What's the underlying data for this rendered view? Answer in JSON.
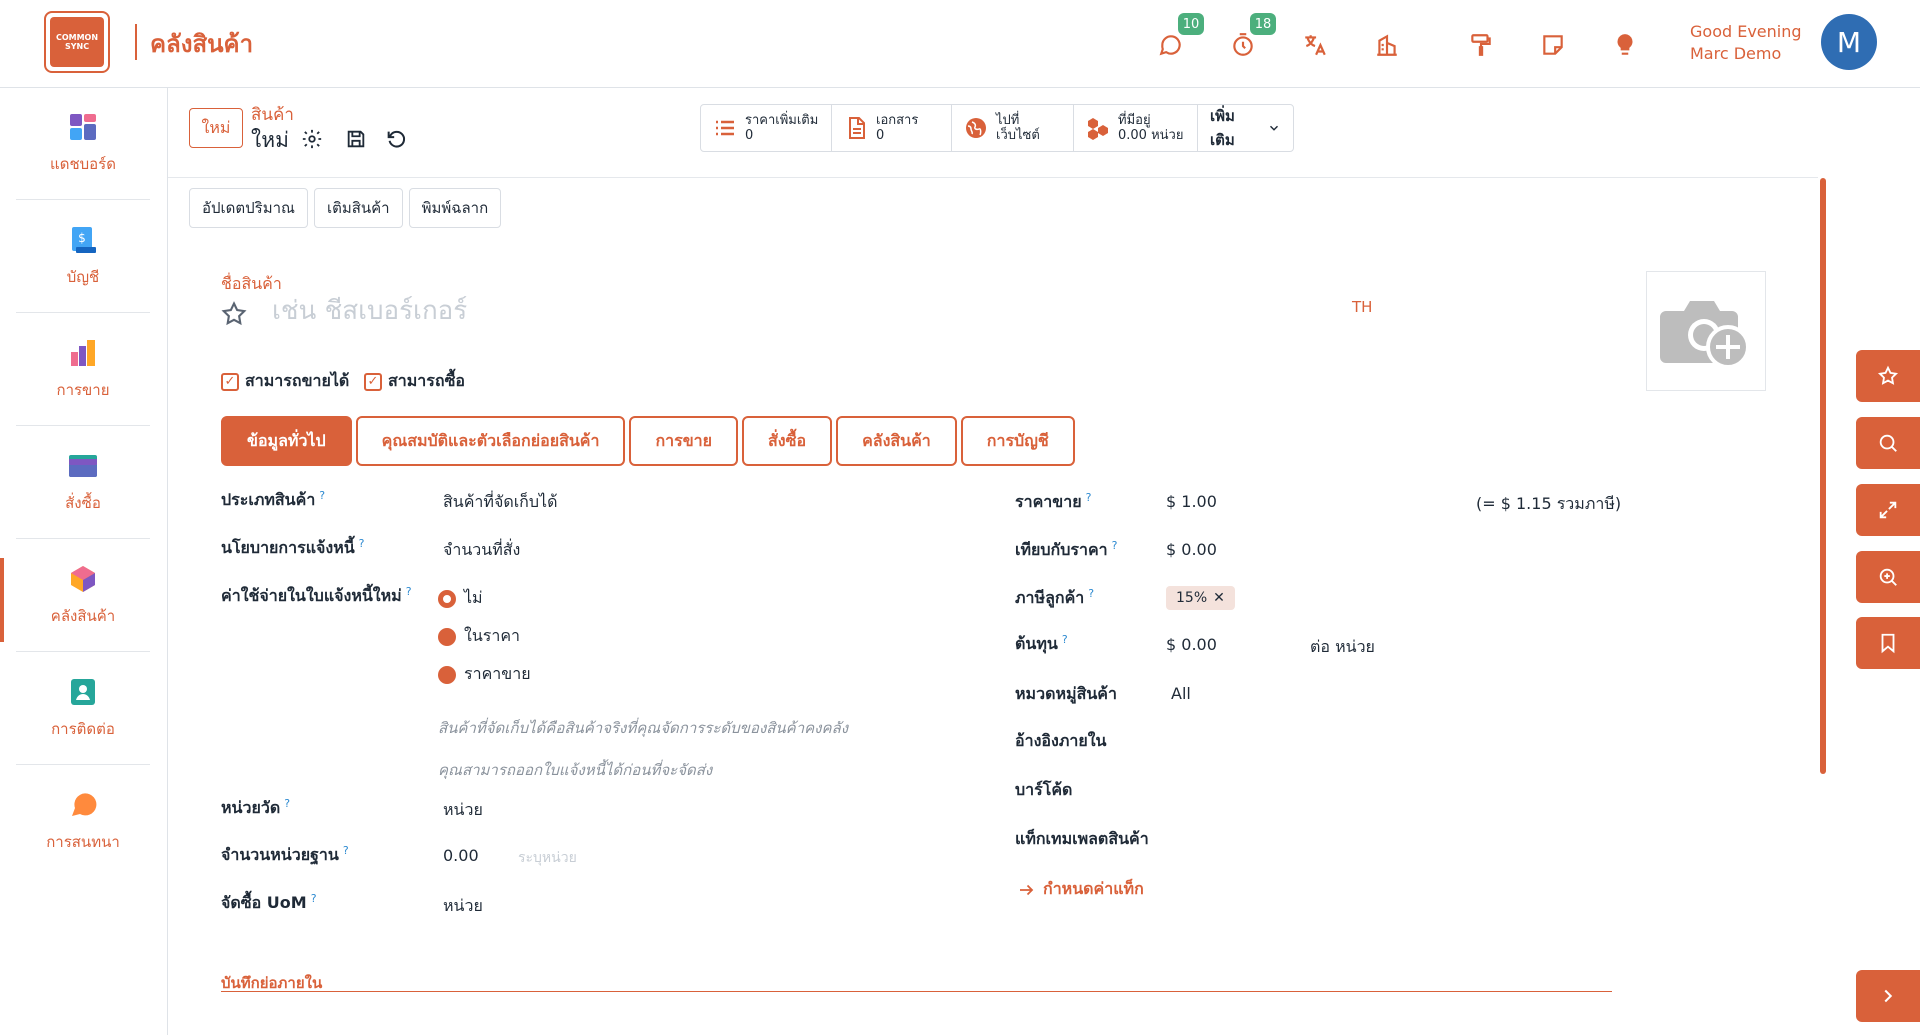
{
  "app": {
    "logo_text": "COMMON SYNC",
    "title": "คลังสินค้า"
  },
  "topbar": {
    "messages_badge": "10",
    "activities_badge": "18",
    "greeting_line1": "Good Evening",
    "greeting_line2": "Marc Demo",
    "avatar_initial": "M"
  },
  "sidebar": {
    "items": [
      {
        "label": "แดชบอร์ด"
      },
      {
        "label": "บัญชี"
      },
      {
        "label": "การขาย"
      },
      {
        "label": "สั่งซื้อ"
      },
      {
        "label": "คลังสินค้า"
      },
      {
        "label": "การติดต่อ"
      },
      {
        "label": "การสนทนา"
      }
    ]
  },
  "control": {
    "new_label": "ใหม่",
    "breadcrumb_parent": "สินค้า",
    "breadcrumb_current": "ใหม่"
  },
  "smart_buttons": {
    "extra_prices_label": "ราคาเพิ่มเติม",
    "extra_prices_count": "0",
    "documents_label": "เอกสาร",
    "documents_count": "0",
    "website_line1": "ไปที่",
    "website_line2": "เว็บไซต์",
    "on_hand_label": "ที่มีอยู่",
    "on_hand_value": "0.00 หน่วย",
    "more_label": "เพิ่มเติม"
  },
  "status_buttons": {
    "update_qty": "อัปเดตปริมาณ",
    "replenish": "เติมสินค้า",
    "print_labels": "พิมพ์ฉลาก"
  },
  "form": {
    "name_label": "ชื่อสินค้า",
    "name_placeholder": "เช่น ชีสเบอร์เกอร์",
    "lang": "TH",
    "can_be_sold": "สามารถขายได้",
    "can_be_purchased": "สามารถซื้อ"
  },
  "tabs": [
    {
      "label": "ข้อมูลทั่วไป"
    },
    {
      "label": "คุณสมบัติและตัวเลือกย่อยสินค้า"
    },
    {
      "label": "การขาย"
    },
    {
      "label": "สั่งซื้อ"
    },
    {
      "label": "คลังสินค้า"
    },
    {
      "label": "การบัญชี"
    }
  ],
  "left_fields": {
    "product_type_label": "ประเภทสินค้า",
    "product_type_value": "สินค้าที่จัดเก็บได้",
    "invoice_policy_label": "นโยบายการแจ้งหนี้",
    "invoice_policy_value": "จำนวนที่สั่ง",
    "reinvoice_label": "ค่าใช้จ่ายในใบแจ้งหนี้ใหม่",
    "reinvoice_options": [
      "ไม่",
      "ในราคา",
      "ราคาขาย"
    ],
    "hint_line1": "สินค้าที่จัดเก็บได้คือสินค้าจริงที่คุณจัดการระดับของสินค้าคงคลัง",
    "hint_line2": "คุณสามารถออกใบแจ้งหนี้ได้ก่อนที่จะจัดส่ง",
    "uom_label": "หน่วยวัด",
    "uom_value": "หน่วย",
    "base_units_label": "จำนวนหน่วยฐาน",
    "base_units_value": "0.00",
    "base_units_placeholder": "ระบุหน่วย",
    "purchase_uom_label": "จัดซื้อ UoM",
    "purchase_uom_value": "หน่วย"
  },
  "right_fields": {
    "sales_price_label": "ราคาขาย",
    "sales_price_value": "$ 1.00",
    "sales_price_incl": "(= $ 1.15 รวมภาษี)",
    "compare_price_label": "เทียบกับราคา",
    "compare_price_value": "$ 0.00",
    "customer_tax_label": "ภาษีลูกค้า",
    "customer_tax_value": "15%",
    "cost_label": "ต้นทุน",
    "cost_value": "$ 0.00",
    "cost_unit": "ต่อ หน่วย",
    "category_label": "หมวดหมู่สินค้า",
    "category_value": "All",
    "internal_ref_label": "อ้างอิงภายใน",
    "barcode_label": "บาร์โค้ด",
    "tag_template_label": "แท็กเทมเพลตสินค้า",
    "configure_tags_link": "กำหนดค่าแท็ก"
  },
  "notes": {
    "label": "บันทึกย่อภายใน"
  },
  "colors": {
    "accent": "#D9613A",
    "badge": "#4caf7d",
    "avatar": "#2f6db3"
  }
}
